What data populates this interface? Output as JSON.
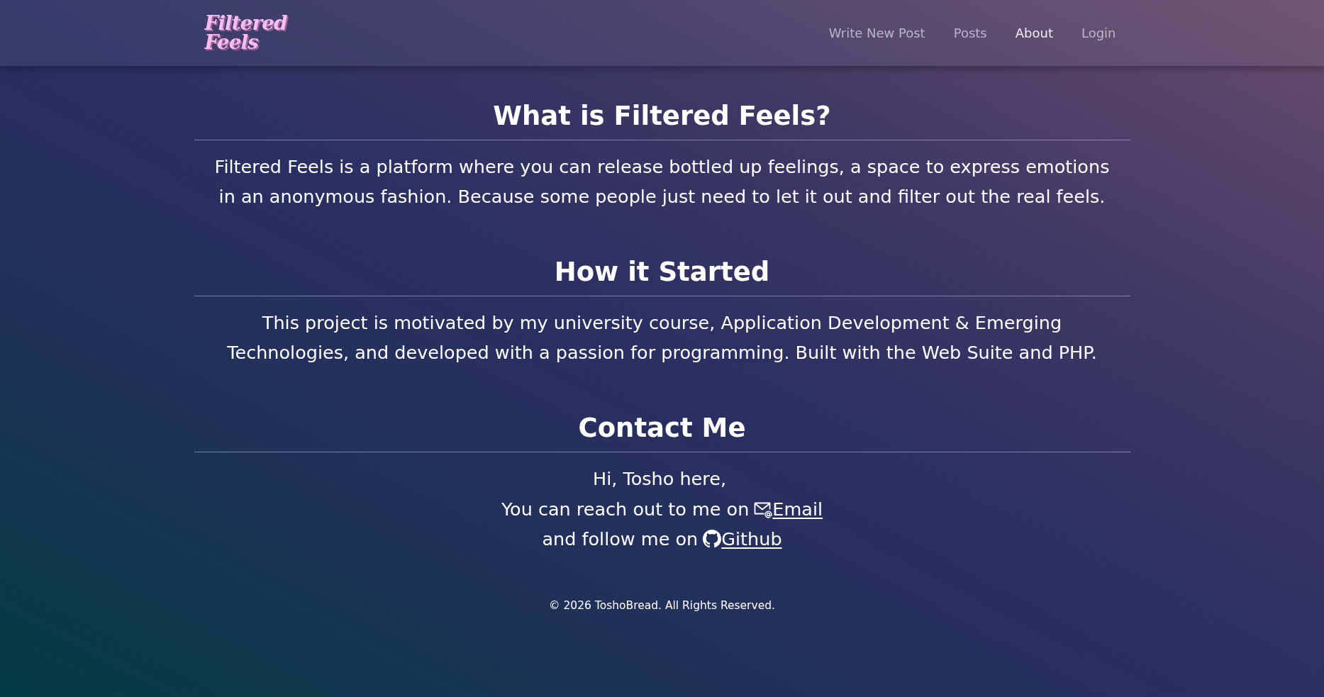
{
  "navbar": {
    "logo": {
      "lines": [
        "Filtered",
        "Feels"
      ]
    },
    "items": [
      {
        "label": "Write New Post",
        "selected": false
      },
      {
        "label": "Posts",
        "selected": false
      },
      {
        "label": "About",
        "selected": true
      },
      {
        "label": "Login",
        "selected": false
      }
    ]
  },
  "about_sections": [
    {
      "heading": "What is Filtered Feels?",
      "body": "Filtered Feels is a platform where you can release bottled up feelings, a space to express emotions in an anonymous fashion. Because some people just need to let it out and filter out the real feels."
    },
    {
      "heading": "How it Started",
      "body": "This project is motivated by my university course, Application Development & Emerging Technologies, and developed with a passion for programming. Built with the Web Suite and PHP."
    }
  ],
  "contact": {
    "heading": "Contact Me",
    "greeting": "Hi, Tosho here,",
    "links": [
      {
        "kind": "email",
        "text": "You can reach out to me on",
        "label": "Email"
      },
      {
        "kind": "github",
        "text": "and follow me on",
        "label": "Github"
      }
    ]
  },
  "footer": {
    "copyright": "© 2026 ToshoBread. All Rights Reserved."
  }
}
